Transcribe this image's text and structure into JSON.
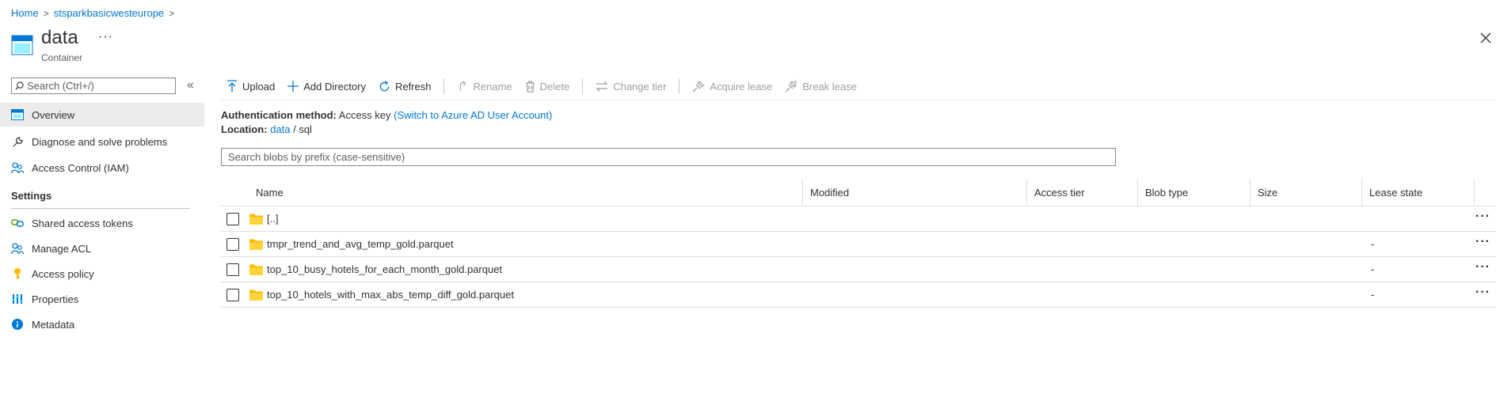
{
  "breadcrumb": {
    "items": [
      "Home",
      "stsparkbasicwesteurope"
    ],
    "separator": ">"
  },
  "header": {
    "title": "data",
    "subtitle": "Container",
    "more": "···"
  },
  "sidebar": {
    "search_placeholder": "Search (Ctrl+/)",
    "collapse": "«",
    "items": [
      {
        "label": "Overview",
        "icon": "container-overview-icon",
        "active": true
      },
      {
        "label": "Diagnose and solve problems",
        "icon": "wrench-icon"
      },
      {
        "label": "Access Control (IAM)",
        "icon": "people-icon"
      }
    ],
    "settings_heading": "Settings",
    "settings_items": [
      {
        "label": "Shared access tokens",
        "icon": "link-icon"
      },
      {
        "label": "Manage ACL",
        "icon": "people-icon"
      },
      {
        "label": "Access policy",
        "icon": "key-icon"
      },
      {
        "label": "Properties",
        "icon": "properties-bars-icon"
      },
      {
        "label": "Metadata",
        "icon": "info-icon"
      }
    ]
  },
  "toolbar": {
    "upload": "Upload",
    "add_directory": "Add Directory",
    "refresh": "Refresh",
    "rename": "Rename",
    "delete": "Delete",
    "change_tier": "Change tier",
    "acquire_lease": "Acquire lease",
    "break_lease": "Break lease"
  },
  "info": {
    "auth_label": "Authentication method:",
    "auth_value": "Access key",
    "auth_link": "(Switch to Azure AD User Account)",
    "location_label": "Location:",
    "location_link": "data",
    "location_sep": "/",
    "location_path": "sql"
  },
  "blob_search": {
    "placeholder": "Search blobs by prefix (case-sensitive)"
  },
  "table": {
    "columns": [
      "Name",
      "Modified",
      "Access tier",
      "Blob type",
      "Size",
      "Lease state"
    ],
    "rows": [
      {
        "name": "[..]",
        "lease_state": "",
        "more": "···"
      },
      {
        "name": "tmpr_trend_and_avg_temp_gold.parquet",
        "lease_state": "-",
        "more": "···"
      },
      {
        "name": "top_10_busy_hotels_for_each_month_gold.parquet",
        "lease_state": "-",
        "more": "···"
      },
      {
        "name": "top_10_hotels_with_max_abs_temp_diff_gold.parquet",
        "lease_state": "-",
        "more": "···"
      }
    ]
  },
  "colors": {
    "accent": "#0078d4",
    "folder": "#ffb900",
    "active_nav": "#edebe9"
  }
}
